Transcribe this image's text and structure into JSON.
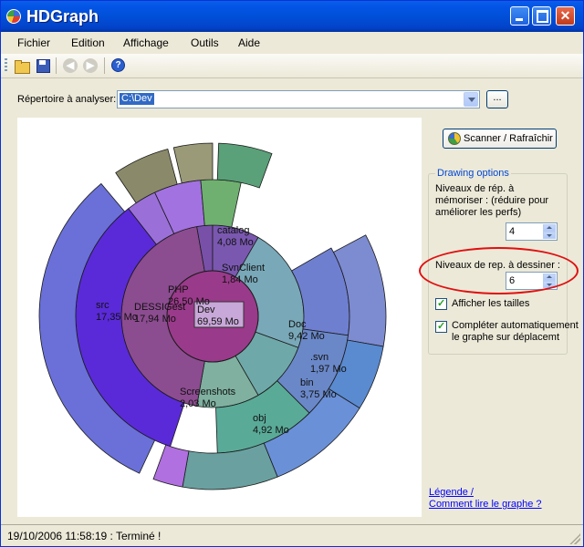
{
  "window": {
    "title": "HDGraph"
  },
  "menu": [
    {
      "label": "Fichier"
    },
    {
      "label": "Edition"
    },
    {
      "label": "Affichage"
    },
    {
      "label": "Outils"
    },
    {
      "label": "Aide"
    }
  ],
  "toolbar": {
    "icons": [
      "folder-open-icon",
      "save-icon",
      "back-icon",
      "forward-icon",
      "help-icon"
    ],
    "help_glyph": "?"
  },
  "directory": {
    "label": "Répertoire à analyser:",
    "value": "C:\\Dev",
    "browse_label": "..."
  },
  "graph": {
    "root": {
      "name": "Dev",
      "size": "69,59 Mo"
    },
    "labels": [
      {
        "name": "PHP",
        "size": "26,50 Mo"
      },
      {
        "name": "DESSIGest",
        "size": "17,94 Mo"
      },
      {
        "name": "src",
        "size": "17,35 Mo"
      },
      {
        "name": "catalog",
        "size": "4,08 Mo"
      },
      {
        "name": "SvnClient",
        "size": "1,84 Mo"
      },
      {
        "name": "Doc",
        "size": "9,42 Mo"
      },
      {
        "name": ".svn",
        "size": "1,97 Mo"
      },
      {
        "name": "bin",
        "size": "3,75 Mo"
      },
      {
        "name": "obj",
        "size": "4,92 Mo"
      },
      {
        "name": "Screenshots",
        "size": "2,03 Mo"
      }
    ]
  },
  "scan_button": {
    "label": "Scanner / Rafraîchir"
  },
  "options": {
    "title": "Drawing options",
    "memorize_label_1": "Niveaux de rép. à",
    "memorize_label_2": "mémoriser : (réduire pour",
    "memorize_label_3": "améliorer les perfs)",
    "memorize_value": "4",
    "draw_label": "Niveaux de rep. à dessiner :",
    "draw_value": "6",
    "show_sizes_label": "Afficher les tailles",
    "auto_complete_label_1": "Compléter automatiquement",
    "auto_complete_label_2": "le graphe sur déplacemt",
    "highlight_color": "#e01010"
  },
  "links": {
    "legend": "Légende /",
    "how_to_read": "Comment lire le graphe ?"
  },
  "status": {
    "text": "19/10/2006 11:58:19 : Terminé !"
  }
}
